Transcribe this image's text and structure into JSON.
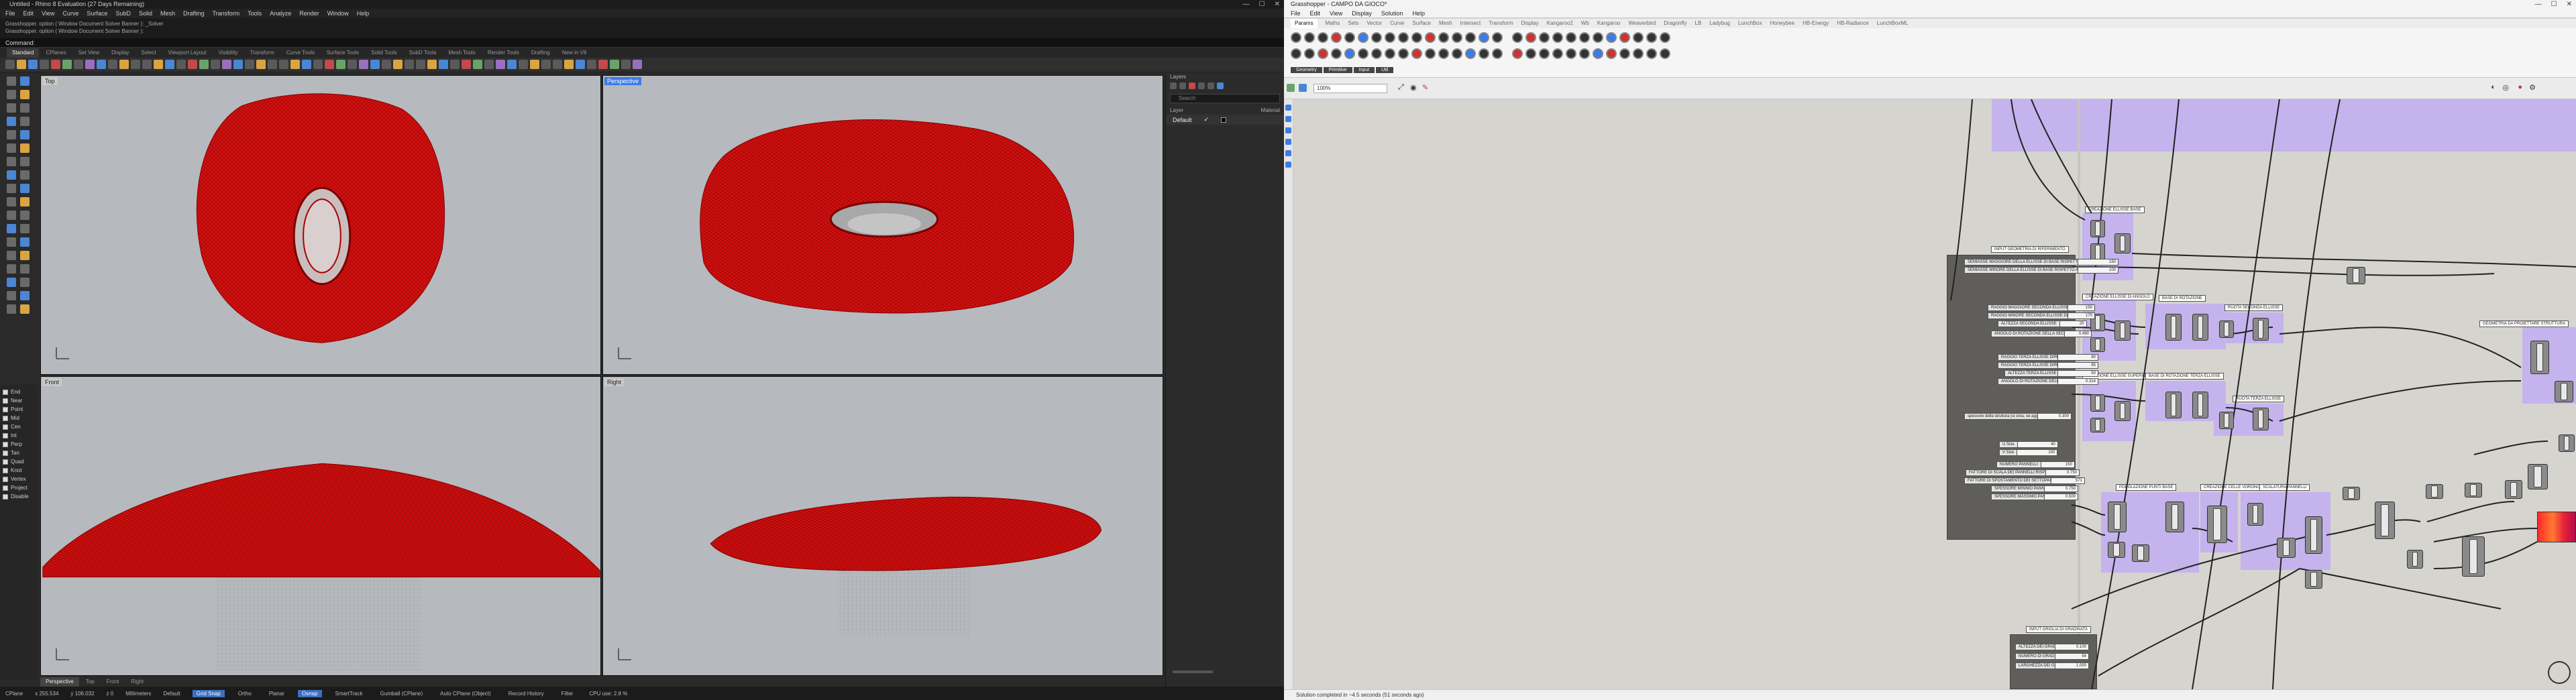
{
  "rhino": {
    "title": "Untitled - Rhino 8 Evaluation (27 Days Remaining)",
    "menu": [
      "File",
      "Edit",
      "View",
      "Curve",
      "Surface",
      "SubD",
      "Solid",
      "Mesh",
      "Drafting",
      "Transform",
      "Tools",
      "Analyze",
      "Render",
      "Window",
      "Help"
    ],
    "command_history": [
      "Grasshopper. option ( Window  Document  Solver  Banner ): _Solver",
      "Grasshopper. option ( Window  Document  Solver  Banner ):"
    ],
    "command_prompt": "Command:",
    "toolbar_tabs": [
      "Standard",
      "CPlanes",
      "Set View",
      "Display",
      "Select",
      "Viewport Layout",
      "Visibility",
      "Transform",
      "Curve Tools",
      "Surface Tools",
      "Solid Tools",
      "SubD Tools",
      "Mesh Tools",
      "Render Tools",
      "Drafting",
      "New in V8"
    ],
    "viewports": {
      "top": "Top",
      "perspective": "Perspective",
      "front": "Front",
      "right": "Right"
    },
    "viewport_tabs": [
      "Perspective",
      "Top",
      "Front",
      "Right"
    ],
    "osnap": [
      "End",
      "Near",
      "Point",
      "Mid",
      "Cen",
      "Int",
      "Perp",
      "Tan",
      "Quad",
      "Knot",
      "Vertex",
      "Project",
      "Disable"
    ],
    "layers": {
      "panel_title": "Layers",
      "search_placeholder": "Search",
      "col_layer": "Layer",
      "col_material": "Material",
      "default_layer": "Default"
    },
    "status": {
      "cplane": "CPlane",
      "x": "x 255.534",
      "y": "y 106.032",
      "z": "z 0",
      "units": "Millimeters",
      "layer": "Default",
      "toggles": [
        "Grid Snap",
        "Ortho",
        "Planar",
        "Osnap",
        "SmartTrack",
        "Gumball (CPlane)",
        "Auto CPlane (Object)",
        "Record History",
        "Filter"
      ],
      "active_toggles": [
        "Grid Snap",
        "Osnap"
      ],
      "cpu": "CPU use: 2.8 %"
    },
    "colors": {
      "mesh": "#d21010",
      "viewport_bg": "#b6b9bd",
      "active_label": "#3d7be6"
    }
  },
  "grasshopper": {
    "title": "Grasshopper - CAMPO DA GIOCO*",
    "menu": [
      "File",
      "Edit",
      "View",
      "Display",
      "Solution",
      "Help"
    ],
    "tabs": [
      "Params",
      "Maths",
      "Sets",
      "Vector",
      "Curve",
      "Surface",
      "Mesh",
      "Intersect",
      "Transform",
      "Display",
      "Kangaroo2",
      "Wb",
      "Kangaroo",
      "Weaverbird",
      "Dragonfly",
      "LB",
      "Ladybug",
      "LunchBox",
      "Honeybee",
      "HB-Energy",
      "HB-Radiance",
      "LunchBoxML"
    ],
    "ribbon_groups": [
      "Geometry",
      "Primitive",
      "Input",
      "Util"
    ],
    "zoom": "100%",
    "status": "Solution completed in ~4.5 seconds (51 seconds ago)",
    "groups": {
      "input_title": "INPUT GEOMETRIA DI RIFERIMENTO",
      "ellisse1": "CREAZIONE ELLISSE BASE",
      "ellisse2": "CREAZIONE ELLISSE DI ANGOLO",
      "rotazione": "BASE DI ROTAZIONE",
      "rotazione2": "BASE DI ROTAZIONE TERZA ELLISSE",
      "ellisse3": "CREAZIONE ELLISSE SUPERIORE",
      "rotate2": "RUOTA SECONDA ELLISSE",
      "rotate3": "RUOTA TERZA ELLISSE",
      "geom": "GEOMETRIA DA PROIETTARE STRUTTURA",
      "punti": "POPOLAZIONE PUNTI BASE",
      "celle": "CREAZIONE CELLE VORONOI",
      "scaling": "SCALATURA PANNELLI",
      "griglia": "INPUT GRIGLIA DI GRADINATA"
    },
    "sliders": [
      {
        "label": "SEMIASSE MAGGIORE DELLA ELLISSE DI BASE RISPETTO ALLE LINEE DEL CAMPO DA GIOCO DIREZIONE X",
        "value": "150"
      },
      {
        "label": "SEMIASSE MINORE DELLA ELLISSE DI BASE RISPETTO AL CAMPO DA GIOCO IN DIREZIONE Y",
        "value": "100"
      },
      {
        "label": "RAGGIO MAGGIORE SECONDA ELLISSE DIREZIONE X",
        "value": "150"
      },
      {
        "label": "RAGGIO MINORE SECONDA ELLISSE DIREZIONE Y",
        "value": "170"
      },
      {
        "label": "ALTEZZA SECONDA ELLISSE",
        "value": "20"
      },
      {
        "label": "ANGOLO DI ROTAZIONE DELLA SECONDA ELLISSE",
        "value": "0.490"
      },
      {
        "label": "RAGGIO TERZA ELLISSE DIREZIONE X",
        "value": "80"
      },
      {
        "label": "RAGGIO TERZA ELLISSE DIREZIONE Y",
        "value": "85"
      },
      {
        "label": "ALTEZZA TERZA ELLISSE",
        "value": "50"
      },
      {
        "label": "ANGOLO DI ROTAZIONE DELLA TERZA ELLISSE",
        "value": "0.314"
      },
      {
        "label": "spessore della struttura (si crea, se aggiornata, i pannelli)",
        "value": "0.300"
      },
      {
        "label": "U Size",
        "value": "40"
      },
      {
        "label": "V Size",
        "value": "100"
      },
      {
        "label": "NUMERO PANNELLI",
        "value": "150"
      },
      {
        "label": "FATTORE DI SCALA DEI PANNELLI RISPETTO ALLA STRUTTURA",
        "value": "0.750"
      },
      {
        "label": "FATTORE DI SPOSTAMENTO DEI SETTOPANNELLI DEI PANNELLI VORONOI",
        "value": "571"
      },
      {
        "label": "SPESSORE MINIMO PANNELLI",
        "value": "0.750"
      },
      {
        "label": "SPESSORE MASSIMO PANNELLI",
        "value": "0.500"
      },
      {
        "label": "ALTEZZA DEI GRADINI",
        "value": "0.100"
      },
      {
        "label": "NUMERO DI GRADINI",
        "value": "54"
      },
      {
        "label": "LARGHEZZA DEI GRADINI",
        "value": "1.000"
      }
    ],
    "colors": {
      "canvas": "#d6d4ce",
      "group_purple": "#c5b3ee",
      "group_dark": "#5f5e5b"
    }
  }
}
